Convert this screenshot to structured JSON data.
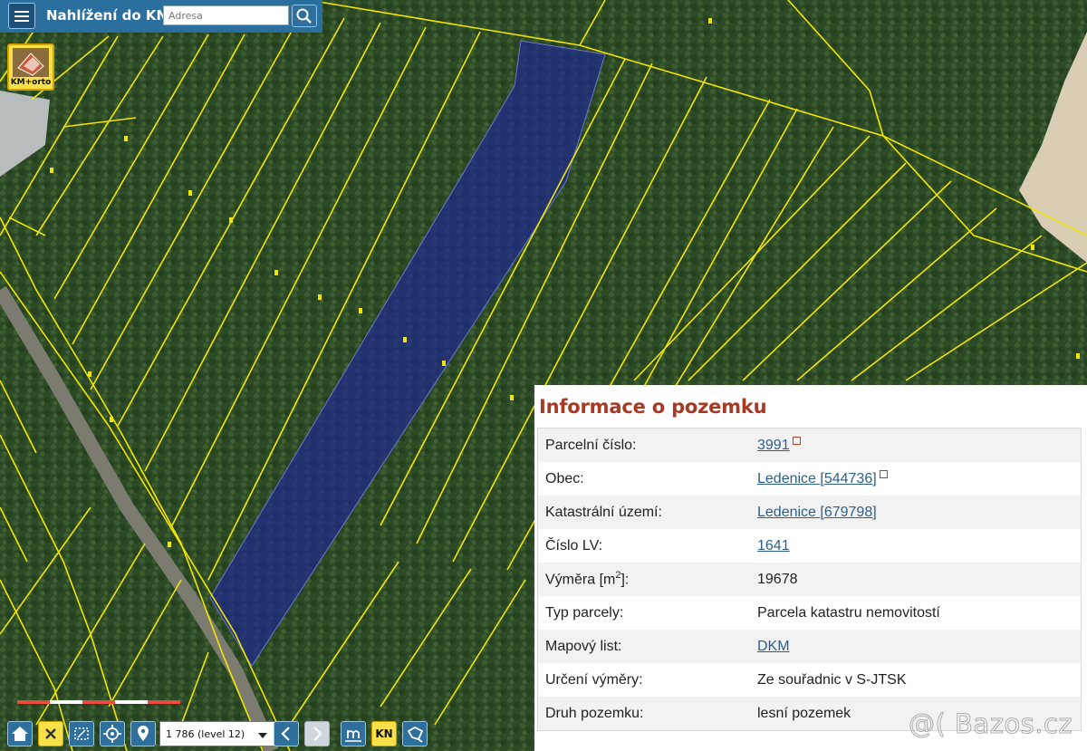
{
  "header": {
    "title": "Nahlížení do KN",
    "search_placeholder": "Adresa"
  },
  "layer_button": {
    "label": "KM+orto"
  },
  "scale": {
    "label": "1 786 (level 12)"
  },
  "toolbar": {
    "kn_label": "KN"
  },
  "info": {
    "title": "Informace o pozemku",
    "rows": [
      {
        "label": "Parcelní číslo:",
        "value": "3991",
        "link": true,
        "external": true
      },
      {
        "label": "Obec:",
        "value": "Ledenice [544736]",
        "link": true,
        "external": true
      },
      {
        "label": "Katastrální území:",
        "value": "Ledenice [679798]",
        "link": true,
        "external": false
      },
      {
        "label": "Číslo LV:",
        "value": "1641",
        "link": true,
        "external": false
      },
      {
        "label_pre": "Výměra [m",
        "label_sup": "2",
        "label_post": "]:",
        "value": "19678",
        "link": false,
        "external": false
      },
      {
        "label": "Typ parcely:",
        "value": "Parcela katastru nemovitostí",
        "link": false,
        "external": false
      },
      {
        "label": "Mapový list:",
        "value": "DKM",
        "link": true,
        "external": false
      },
      {
        "label": "Určení výměry:",
        "value": "Ze souřadnic v S-JTSK",
        "link": false,
        "external": false
      },
      {
        "label": "Druh pozemku:",
        "value": "lesní pozemek",
        "link": false,
        "external": false
      }
    ]
  },
  "watermark": "@( Bazos.cz",
  "colors": {
    "parcel_line": "#f2e600",
    "selected_parcel": "#1e2a8c",
    "header_bg": "#2b6f9e",
    "info_title": "#a63a24",
    "link": "#2b5f8a"
  }
}
